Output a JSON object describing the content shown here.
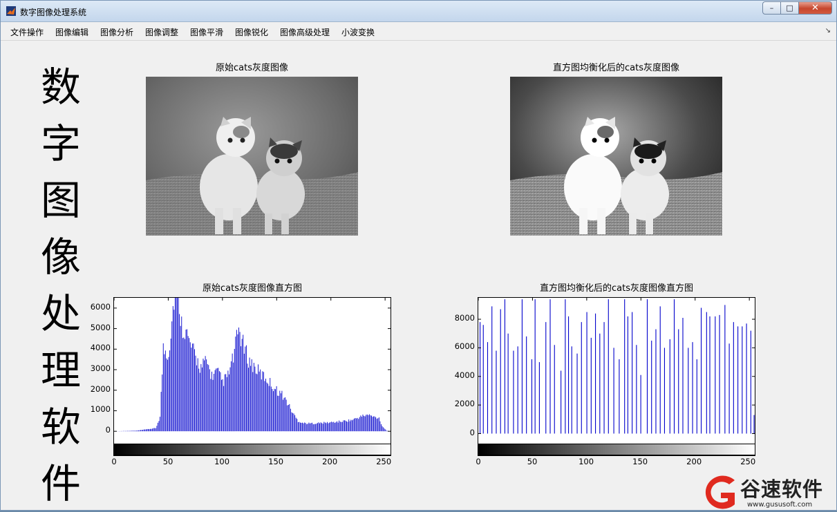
{
  "window": {
    "title": "数字图像处理系统",
    "min_label": "–",
    "max_label": "□",
    "close_label": "✕"
  },
  "menu": {
    "items": [
      "文件操作",
      "图像编辑",
      "图像分析",
      "图像调整",
      "图像平滑",
      "图像锐化",
      "图像高级处理",
      "小波变换"
    ],
    "overflow": "↘"
  },
  "side_title": [
    "数",
    "字",
    "图",
    "像",
    "处",
    "理",
    "软",
    "件"
  ],
  "images": {
    "original_title": "原始cats灰度图像",
    "equalized_title": "直方图均衡化后的cats灰度图像"
  },
  "hist_original": {
    "title": "原始cats灰度图像直方图",
    "y_ticks": [
      "6000",
      "5000",
      "4000",
      "3000",
      "2000",
      "1000",
      "0"
    ],
    "x_ticks": [
      "0",
      "50",
      "100",
      "150",
      "200",
      "250"
    ]
  },
  "hist_equalized": {
    "title": "直方图均衡化后的cats灰度图像直方图",
    "y_ticks": [
      "8000",
      "6000",
      "4000",
      "2000",
      "0"
    ],
    "x_ticks": [
      "0",
      "50",
      "100",
      "150",
      "200",
      "250"
    ]
  },
  "chart_data": [
    {
      "type": "bar",
      "title": "原始cats灰度图像直方图",
      "xlim": [
        0,
        255
      ],
      "ylim": [
        -600,
        6500
      ],
      "x_key_points": [
        0,
        20,
        38,
        42,
        45,
        50,
        55,
        58,
        60,
        62,
        65,
        70,
        75,
        80,
        85,
        90,
        95,
        100,
        105,
        110,
        115,
        120,
        125,
        130,
        135,
        140,
        145,
        150,
        155,
        160,
        165,
        170,
        175,
        180,
        190,
        200,
        210,
        220,
        225,
        230,
        235,
        240,
        245,
        248,
        252,
        255
      ],
      "y_key_points": [
        0,
        30,
        150,
        700,
        4000,
        3800,
        6500,
        6500,
        6200,
        5200,
        5000,
        4200,
        3600,
        3100,
        3400,
        2700,
        2900,
        2400,
        2700,
        3600,
        5000,
        4000,
        3400,
        3100,
        2800,
        2600,
        2300,
        2000,
        1800,
        1400,
        900,
        500,
        400,
        380,
        400,
        430,
        480,
        550,
        650,
        750,
        800,
        700,
        650,
        250,
        30,
        0
      ]
    },
    {
      "type": "bar",
      "title": "直方图均衡化后的cats灰度图像直方图",
      "xlim": [
        0,
        255
      ],
      "ylim": [
        -700,
        9500
      ],
      "x_bins": [
        1,
        4,
        8,
        12,
        16,
        20,
        24,
        27,
        32,
        36,
        40,
        44,
        49,
        52,
        56,
        62,
        66,
        70,
        76,
        80,
        83,
        86,
        91,
        95,
        100,
        104,
        108,
        112,
        116,
        120,
        125,
        130,
        135,
        138,
        142,
        146,
        150,
        156,
        160,
        164,
        168,
        172,
        177,
        181,
        185,
        189,
        194,
        198,
        202,
        206,
        211,
        214,
        219,
        223,
        228,
        232,
        236,
        240,
        244,
        248,
        252,
        255
      ],
      "y_values": [
        7800,
        7600,
        6400,
        8900,
        5800,
        8700,
        9400,
        7000,
        5800,
        6100,
        9400,
        6800,
        5200,
        9400,
        5000,
        7800,
        9400,
        6200,
        4400,
        9400,
        8200,
        6100,
        5600,
        7800,
        8500,
        6700,
        8400,
        7000,
        7800,
        9400,
        6000,
        5200,
        9400,
        8200,
        8500,
        6200,
        4100,
        9400,
        6500,
        7300,
        8900,
        6000,
        6600,
        9400,
        7300,
        8100,
        6000,
        6400,
        5200,
        8800,
        8500,
        8200,
        8200,
        8300,
        9000,
        6300,
        7800,
        7500,
        7500,
        7700,
        7200,
        1300
      ]
    }
  ],
  "watermark": {
    "brand": "谷速软件",
    "url": "www.gususoft.com"
  }
}
